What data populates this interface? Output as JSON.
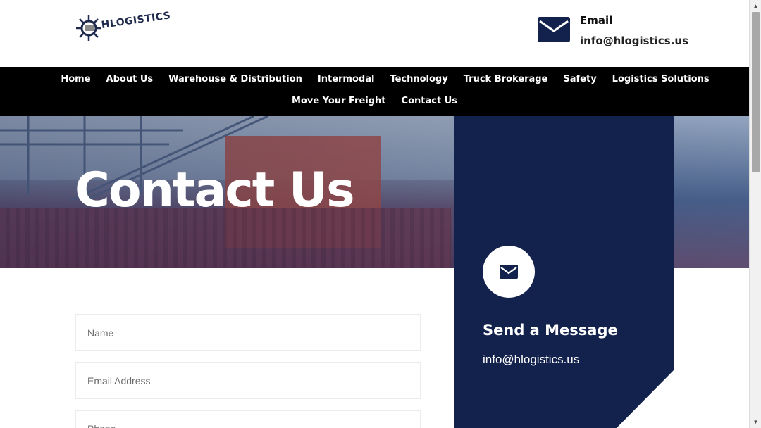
{
  "header": {
    "logo_text": "HLOGISTICS",
    "email_label": "Email",
    "email_value": "info@hlogistics.us",
    "email_icon": "envelope-icon"
  },
  "nav": {
    "row1": [
      "Home",
      "About Us",
      "Warehouse & Distribution",
      "Intermodal",
      "Technology",
      "Truck Brokerage",
      "Safety",
      "Logistics Solutions"
    ],
    "row2": [
      "Move Your Freight",
      "Contact Us"
    ]
  },
  "hero": {
    "title": "Contact Us"
  },
  "side_panel": {
    "icon": "envelope-icon",
    "title": "Send a Message",
    "email": "info@hlogistics.us",
    "bg_color": "#13214d"
  },
  "form": {
    "name_placeholder": "Name",
    "email_placeholder": "Email Address",
    "phone_placeholder": "Phone"
  },
  "colors": {
    "navy": "#13214d",
    "nav_bg": "#000000"
  }
}
